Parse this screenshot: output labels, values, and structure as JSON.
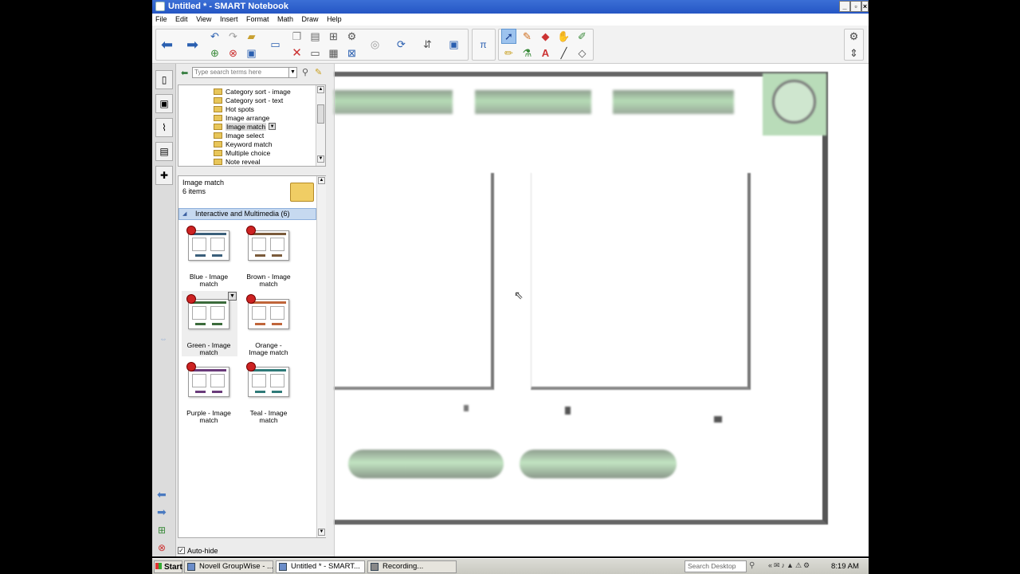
{
  "window": {
    "title": "Untitled * - SMART Notebook"
  },
  "menu": [
    "File",
    "Edit",
    "View",
    "Insert",
    "Format",
    "Math",
    "Draw",
    "Help"
  ],
  "gallery": {
    "search_placeholder": "Type search terms here",
    "tree_items": [
      "Category sort - image",
      "Category sort - text",
      "Hot spots",
      "Image arrange",
      "Image match",
      "Image select",
      "Keyword match",
      "Multiple choice",
      "Note reveal"
    ],
    "selected_item": "Image match",
    "folder_title": "Image match",
    "folder_count": "6 items",
    "group_header": "Interactive and Multimedia (6)",
    "thumbnails": [
      {
        "label1": "Blue - Image",
        "label2": "match",
        "color": "#3a5f7a"
      },
      {
        "label1": "Brown - Image",
        "label2": "match",
        "color": "#7a5a3a"
      },
      {
        "label1": "Green - Image",
        "label2": "match",
        "color": "#3b6b3b"
      },
      {
        "label1": "Orange -",
        "label2": "Image match",
        "color": "#c0653a"
      },
      {
        "label1": "Purple - Image",
        "label2": "match",
        "color": "#6a3b7a"
      },
      {
        "label1": "Teal - Image",
        "label2": "match",
        "color": "#2f7a78"
      }
    ],
    "autohide_label": "Auto-hide"
  },
  "taskbar": {
    "start": "Start",
    "tasks": [
      "Novell GroupWise - ...",
      "Untitled * - SMART...",
      "Recording..."
    ],
    "search_placeholder": "Search Desktop",
    "clock": "8:19 AM"
  },
  "colors": {
    "accent_green": "#a6d3a6",
    "title_blue": "#2556c4"
  }
}
